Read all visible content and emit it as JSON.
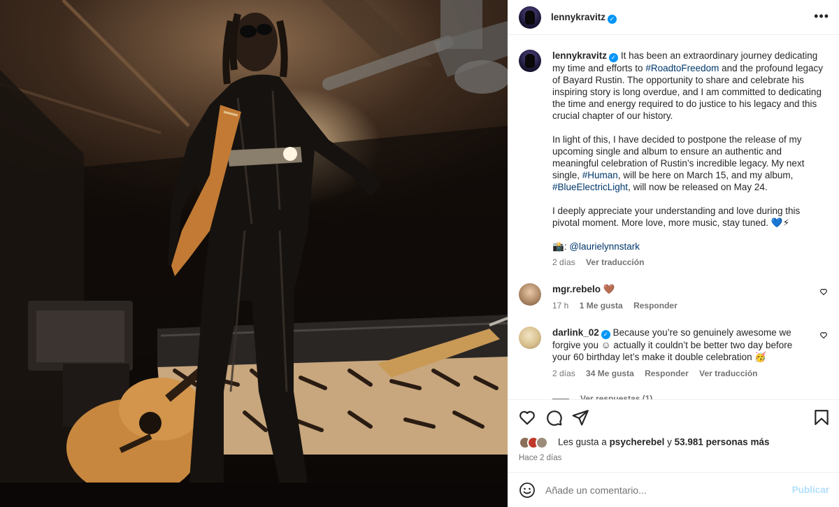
{
  "header": {
    "username": "lennykravitz",
    "more_icon": "more-horizontal-icon"
  },
  "caption": {
    "username": "lennykravitz",
    "p1_a": "It has been an extraordinary journey dedicating my time and efforts to ",
    "p1_tag": "#RoadtoFreedom",
    "p1_b": " and the profound legacy of Bayard Rustin. The opportunity to share and celebrate his inspiring story is long overdue, and I am committed to dedicating the time and energy required to do justice to his legacy and this crucial chapter of our history.",
    "p2_a": "In light of this, I have decided to postpone the release of my upcoming single and album to ensure an authentic and meaningful celebration of Rustin’s incredible legacy. My next single, ",
    "p2_tag1": "#Human",
    "p2_b": ", will be here on March 15, and my album, ",
    "p2_tag2": "#BlueElectricLight",
    "p2_c": ", will now be released on May 24.",
    "p3": "I deeply appreciate your understanding and love during this pivotal moment. More love, more music, stay tuned. 💙⚡",
    "credit_emoji": "📸: ",
    "credit_mention": "@laurielynnstark",
    "time": "2 días",
    "translate": "Ver traducción"
  },
  "comments": [
    {
      "username": "mgr.rebelo",
      "text": "🤎",
      "time": "17 h",
      "likes": "1 Me gusta",
      "reply": "Responder"
    },
    {
      "username": "darlink_02",
      "text": "Because you’re so genuinely awesome we forgive you ☺ actually it couldn’t be better two day before your 60 birthday let’s make it double celebration 🥳",
      "time": "2 días",
      "likes": "34 Me gusta",
      "reply": "Responder",
      "translate": "Ver traducción"
    }
  ],
  "view_replies": "Ver respuestas (1)",
  "likes": {
    "prefix": "Les gusta a ",
    "user": "psycherebel",
    "middle": " y ",
    "count": "53.981 personas más"
  },
  "posted": "Hace 2 días",
  "add_comment": {
    "placeholder": "Añade un comentario...",
    "publish": "Publicar"
  },
  "colors": {
    "link": "#00376b",
    "verified": "#0095f6",
    "publish_disabled": "#b2dffc",
    "muted": "#737373"
  }
}
